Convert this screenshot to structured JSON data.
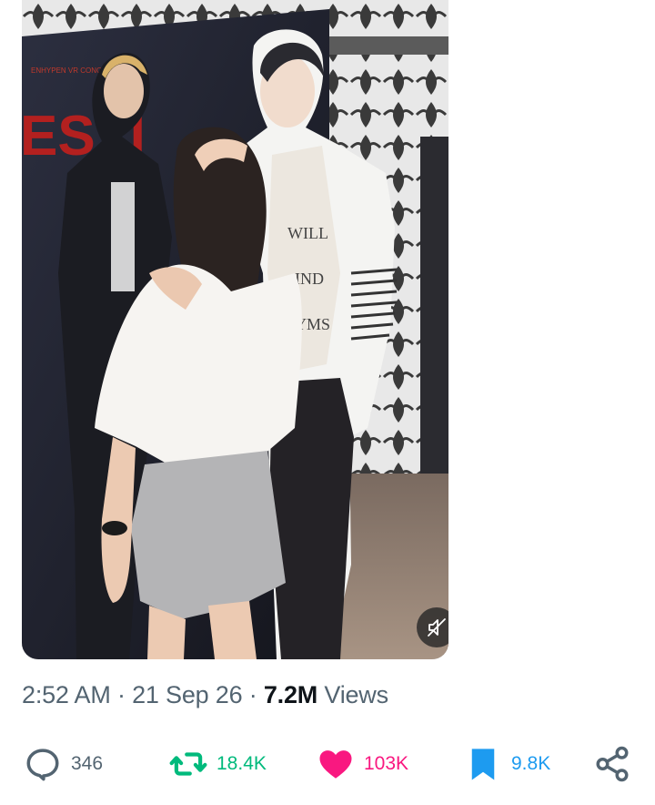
{
  "tweet": {
    "media": {
      "mute_button_icon": "muted-speaker-icon"
    },
    "meta": {
      "time": "2:52 AM",
      "separator": "·",
      "date": "21 Sep 26",
      "views_count": "7.2M",
      "views_label": "Views"
    },
    "actions": {
      "reply": {
        "icon": "reply-icon",
        "count": "346"
      },
      "repost": {
        "icon": "repost-icon",
        "count": "18.4K"
      },
      "like": {
        "icon": "heart-icon",
        "count": "103K",
        "liked": true
      },
      "bookmark": {
        "icon": "bookmark-icon",
        "count": "9.8K",
        "bookmarked": true
      },
      "share": {
        "icon": "share-icon"
      }
    }
  },
  "colors": {
    "text_primary": "#0f1419",
    "text_secondary": "#536471",
    "repost_green": "#00ba7c",
    "like_pink": "#f91880",
    "bookmark_blue": "#1d9bf0"
  }
}
